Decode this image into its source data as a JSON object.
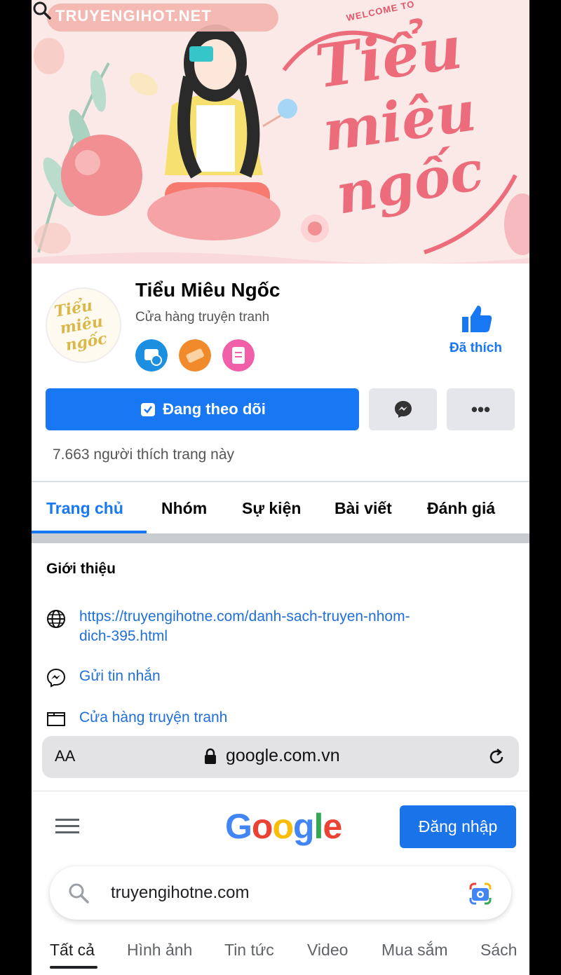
{
  "cover": {
    "watermark": "TRUYENGIHOT.NET",
    "welcome": "WELCOME TO"
  },
  "page": {
    "name": "Tiểu Miêu Ngốc",
    "category": "Cửa hàng truyện tranh",
    "like_label": "Đã thích",
    "follow_label": "Đang theo dõi",
    "more_label": "•••",
    "likes_count": "7.663 người thích trang này"
  },
  "tabs": [
    {
      "label": "Trang chủ",
      "active": true
    },
    {
      "label": "Nhóm",
      "active": false
    },
    {
      "label": "Sự kiện",
      "active": false
    },
    {
      "label": "Bài viết",
      "active": false
    },
    {
      "label": "Đánh giá",
      "active": false
    }
  ],
  "intro": {
    "title": "Giới thiệu",
    "website_line1": "https://truyengihotne.com/danh-sach-truyen-nhom-",
    "website_line2": "dich-395.html",
    "message": "Gửi tin nhắn",
    "category": "Cửa hàng truyện tranh"
  },
  "browser": {
    "aa": "AA",
    "domain": "google.com.vn"
  },
  "google": {
    "logo_letters": [
      "G",
      "o",
      "o",
      "g",
      "l",
      "e"
    ],
    "logo_colors": [
      "#4285F4",
      "#EA4335",
      "#FBBC05",
      "#4285F4",
      "#34A853",
      "#EA4335"
    ],
    "signin_label": "Đăng nhập",
    "query": "truyengihotne.com",
    "tabs": [
      "Tất cả",
      "Hình ảnh",
      "Tin tức",
      "Video",
      "Mua sắm",
      "Sách"
    ]
  },
  "colors": {
    "facebook_blue": "#1877f2",
    "google_blue": "#1a73e8"
  }
}
